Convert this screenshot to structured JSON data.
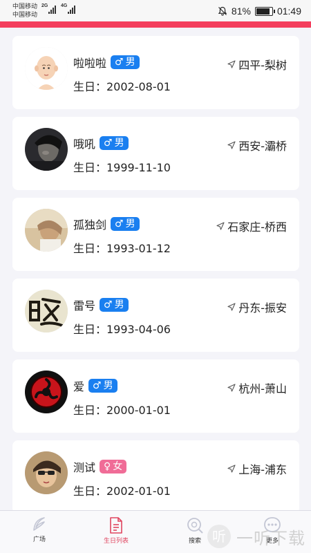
{
  "status_bar": {
    "carrier_1": "中国移动",
    "carrier_2": "中国移动",
    "net_1": "2G",
    "net_2": "4G",
    "battery": "81%",
    "time": "01:49"
  },
  "colors": {
    "accent": "#f43f5e",
    "male_badge": "#1a7ff0",
    "female_badge": "#f06c97",
    "active_tab": "#e0455f"
  },
  "people": [
    {
      "name": "啦啦啦",
      "gender_symbol": "♂",
      "gender": "男",
      "birthday": "生日：2002-08-01",
      "location": "四平-梨树",
      "avatar": "bald-cartoon-avatar"
    },
    {
      "name": "哦吼",
      "gender_symbol": "♂",
      "gender": "男",
      "birthday": "生日：1999-11-10",
      "location": "西安-灞桥",
      "avatar": "dark-photo-avatar"
    },
    {
      "name": "孤独剑",
      "gender_symbol": "♂",
      "gender": "男",
      "birthday": "生日：1993-01-12",
      "location": "石家庄-桥西",
      "avatar": "girl-photo-avatar"
    },
    {
      "name": "雷号",
      "gender_symbol": "♂",
      "gender": "男",
      "birthday": "生日：1993-04-06",
      "location": "丹东-振安",
      "avatar": "calligraphy-avatar"
    },
    {
      "name": "爱",
      "gender_symbol": "♂",
      "gender": "男",
      "birthday": "生日：2000-01-01",
      "location": "杭州-萧山",
      "avatar": "red-eye-avatar"
    },
    {
      "name": "测试",
      "gender_symbol": "♀",
      "gender": "女",
      "birthday": "生日：2002-01-01",
      "location": "上海-浦东",
      "avatar": "sunglasses-avatar"
    }
  ],
  "nav": {
    "plaza": "广场",
    "birthday_list": "生日列表",
    "search": "搜索",
    "more": "更多"
  },
  "watermark": {
    "text": "一听下载",
    "glyph": "听"
  }
}
